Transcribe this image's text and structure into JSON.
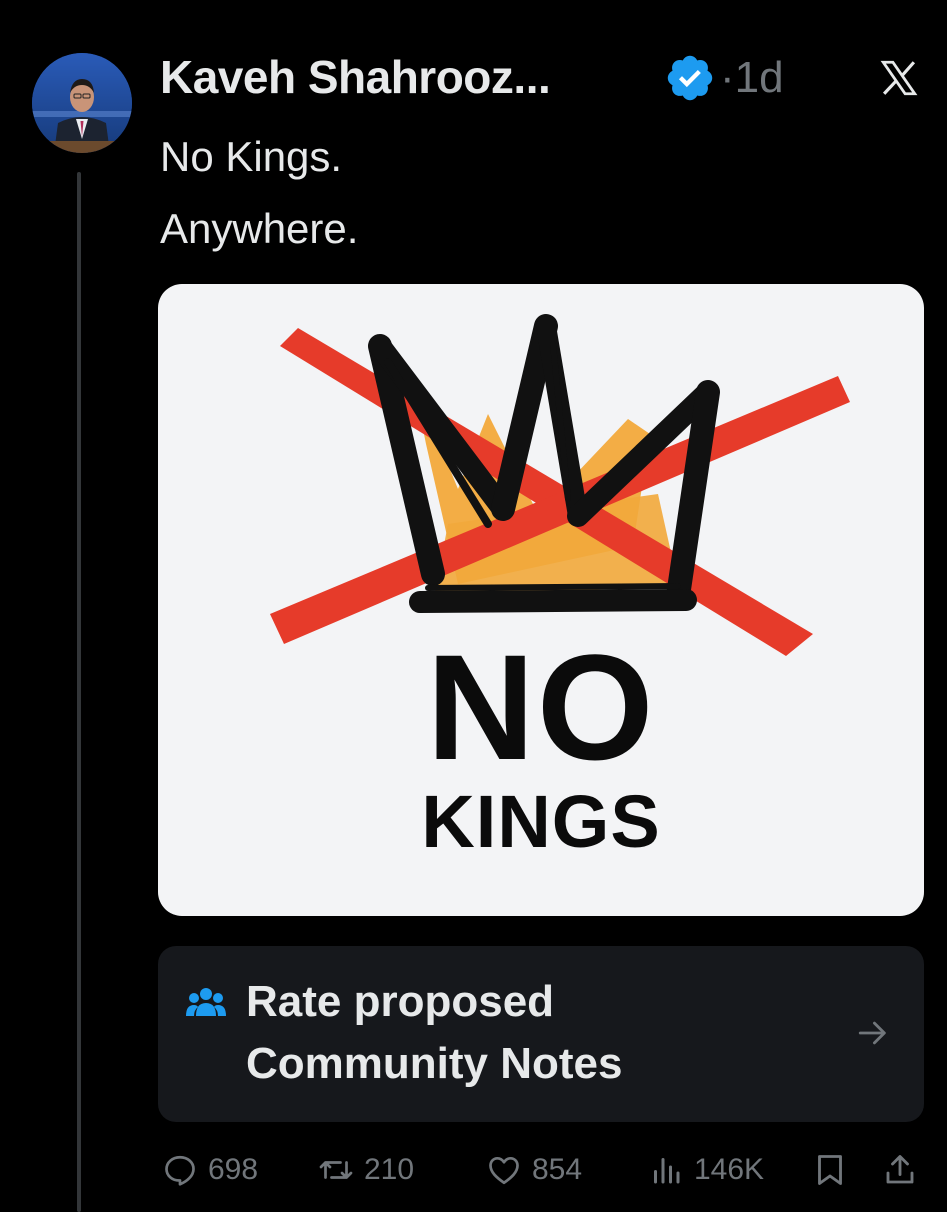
{
  "tweet": {
    "author_name": "Kaveh Shahrooz...",
    "timestamp": "·1d",
    "text_lines": [
      "No Kings.",
      "Anywhere."
    ]
  },
  "icons": {
    "verified": "verified-badge-icon",
    "platform": "x-logo-icon",
    "notes": "community-notes-icon",
    "arrow": "arrow-right-icon",
    "reply": "reply-icon",
    "repost": "repost-icon",
    "like": "like-icon",
    "views": "views-icon",
    "bookmark": "bookmark-icon",
    "share": "share-icon"
  },
  "media": {
    "line_1": "NO",
    "line_2": "KINGS"
  },
  "community_notes": {
    "line_1": "Rate proposed",
    "line_2": "Community Notes"
  },
  "stats": {
    "replies": "698",
    "reposts": "210",
    "likes": "854",
    "views": "146K"
  },
  "colors": {
    "background": "#000000",
    "text": "#e7e9ea",
    "muted": "#71767b",
    "verified": "#1d9bf0",
    "card": "#16181c",
    "poster_red": "#e63b2a",
    "poster_orange": "#f2a93b"
  }
}
